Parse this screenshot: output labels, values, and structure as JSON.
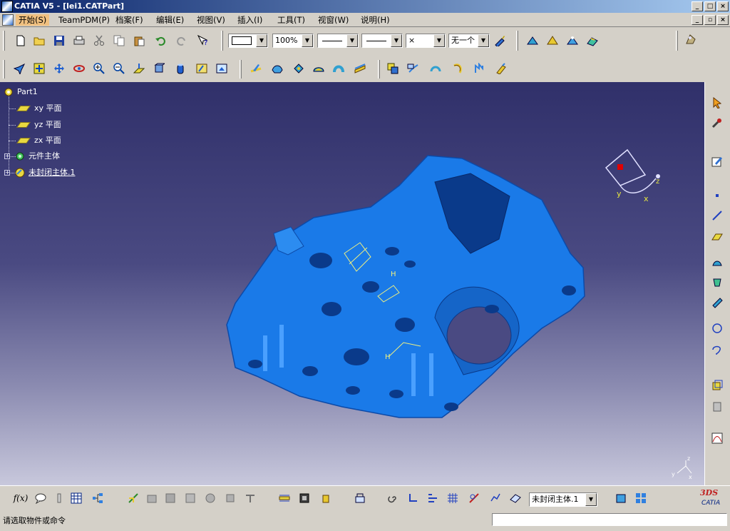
{
  "window": {
    "title": "CATIA V5 - [lei1.CATPart]",
    "btn_min": "_",
    "btn_max": "□",
    "btn_close": "×",
    "child_restore": "▫"
  },
  "menu": [
    {
      "label": "开始(S)",
      "active": true
    },
    {
      "label": "TeamPDM(P)"
    },
    {
      "label": "档案(F)"
    },
    {
      "label": "编辑(E)"
    },
    {
      "label": "视图(V)"
    },
    {
      "label": "插入(I)"
    },
    {
      "label": "工具(T)"
    },
    {
      "label": "视窗(W)"
    },
    {
      "label": "说明(H)"
    }
  ],
  "toolbar1": {
    "zoom_combo": "100%",
    "symbol_combo": "×",
    "layer_combo": "无一个",
    "arrow": "▼"
  },
  "tree": {
    "root": "Part1",
    "items": [
      "xy 平面",
      "yz 平面",
      "zx 平面",
      "元件主体",
      "未封闭主体.1"
    ]
  },
  "compass": {
    "x_label": "x",
    "y_label": "y",
    "z_label": "z"
  },
  "bottom_toolbar": {
    "body_combo": "未封闭主体.1",
    "fx_label": "f(x)"
  },
  "status": {
    "prompt": "请选取物件或命令",
    "command_value": ""
  },
  "logo": {
    "brand": "CATIA",
    "mark": "3DS"
  },
  "colors": {
    "part_blue": "#1a7ae8",
    "viewport_top": "#30306a",
    "viewport_bottom": "#c8c8dc",
    "title_bar": "#0a246a"
  }
}
